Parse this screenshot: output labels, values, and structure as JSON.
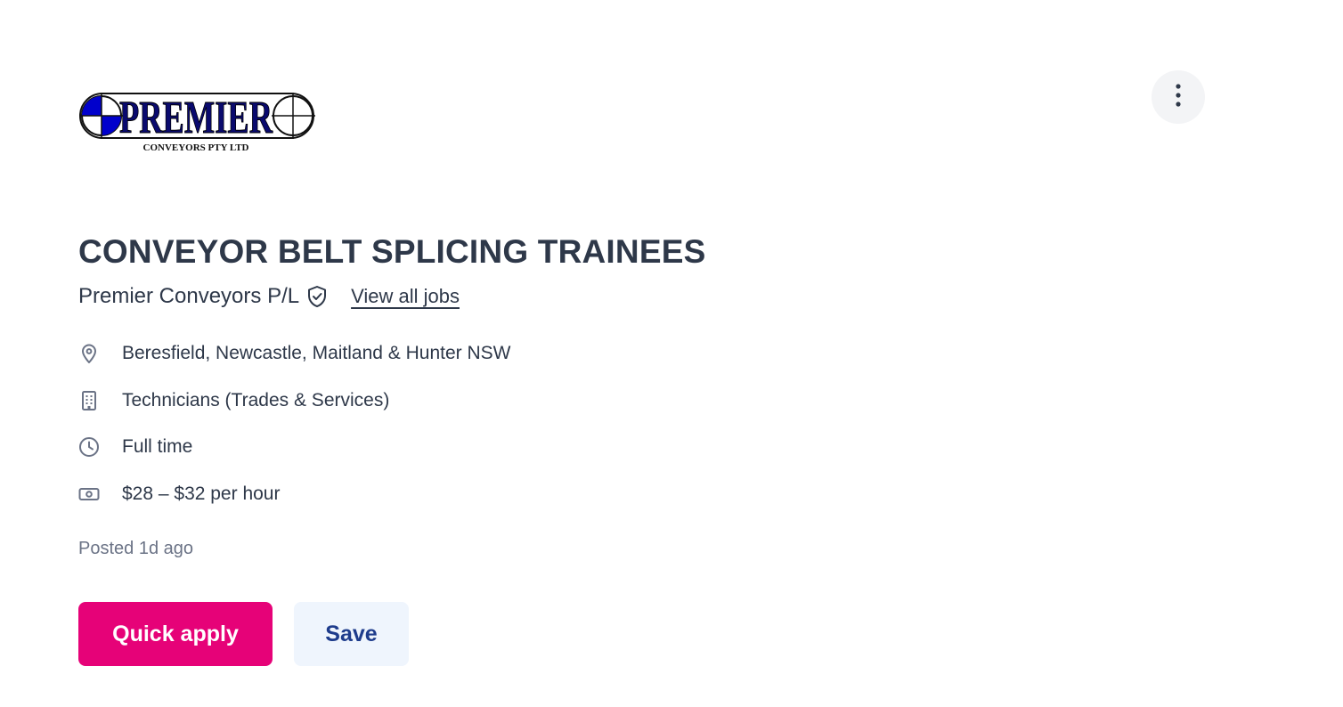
{
  "company_logo": {
    "wordmark": "PREMIER",
    "subtitle": "CONVEYORS PTY LTD"
  },
  "more_button": {
    "icon": "more-vertical-icon"
  },
  "job": {
    "title": "CONVEYOR BELT SPLICING TRAINEES",
    "company": "Premier Conveyors P/L",
    "company_verified_icon": "shield-check-icon",
    "view_all_jobs_label": "View all jobs",
    "details": [
      {
        "icon": "location-pin-icon",
        "text": "Beresfield, Newcastle, Maitland & Hunter NSW"
      },
      {
        "icon": "building-icon",
        "text": "Technicians (Trades & Services)"
      },
      {
        "icon": "clock-icon",
        "text": "Full time"
      },
      {
        "icon": "money-icon",
        "text": "$28 – $32 per hour"
      }
    ],
    "posted": "Posted 1d ago"
  },
  "actions": {
    "quick_apply_label": "Quick apply",
    "save_label": "Save"
  },
  "colors": {
    "primary_pink": "#e60278",
    "save_bg": "#eff5fd",
    "save_text": "#1e3c8c",
    "text": "#2e3849",
    "muted_text": "#6b7386",
    "logo_blue": "#0000cc"
  }
}
